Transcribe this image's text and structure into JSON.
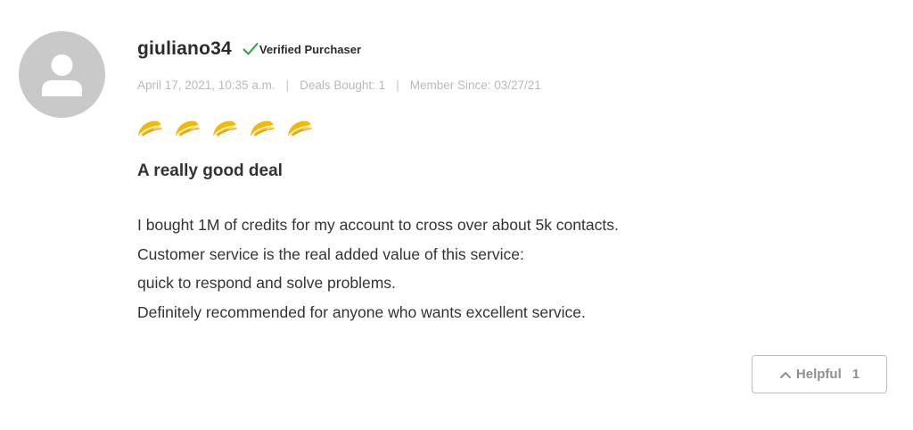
{
  "review": {
    "username": "giuliano34",
    "verified_label": "Verified Purchaser",
    "meta": {
      "date": "April 17, 2021, 10:35 a.m.",
      "deals_bought": "Deals Bought: 1",
      "member_since": "Member Since: 03/27/21",
      "separator": "|"
    },
    "rating": {
      "value": 5,
      "max": 5,
      "icon": "taco-icon",
      "color": "#f5b800"
    },
    "title": "A really good deal",
    "body": [
      "I bought 1M of credits for my account to cross over about 5k contacts.",
      "Customer service is the real added value of this service:",
      "quick to respond and solve problems.",
      "Definitely recommended for anyone who wants excellent service."
    ],
    "helpful": {
      "label": "Helpful",
      "count": "1"
    }
  },
  "colors": {
    "avatar_bg": "#c9c9c9",
    "verified_check": "#2e9e3e",
    "meta_text": "#b9b9b9",
    "taco": "#f5b800"
  }
}
